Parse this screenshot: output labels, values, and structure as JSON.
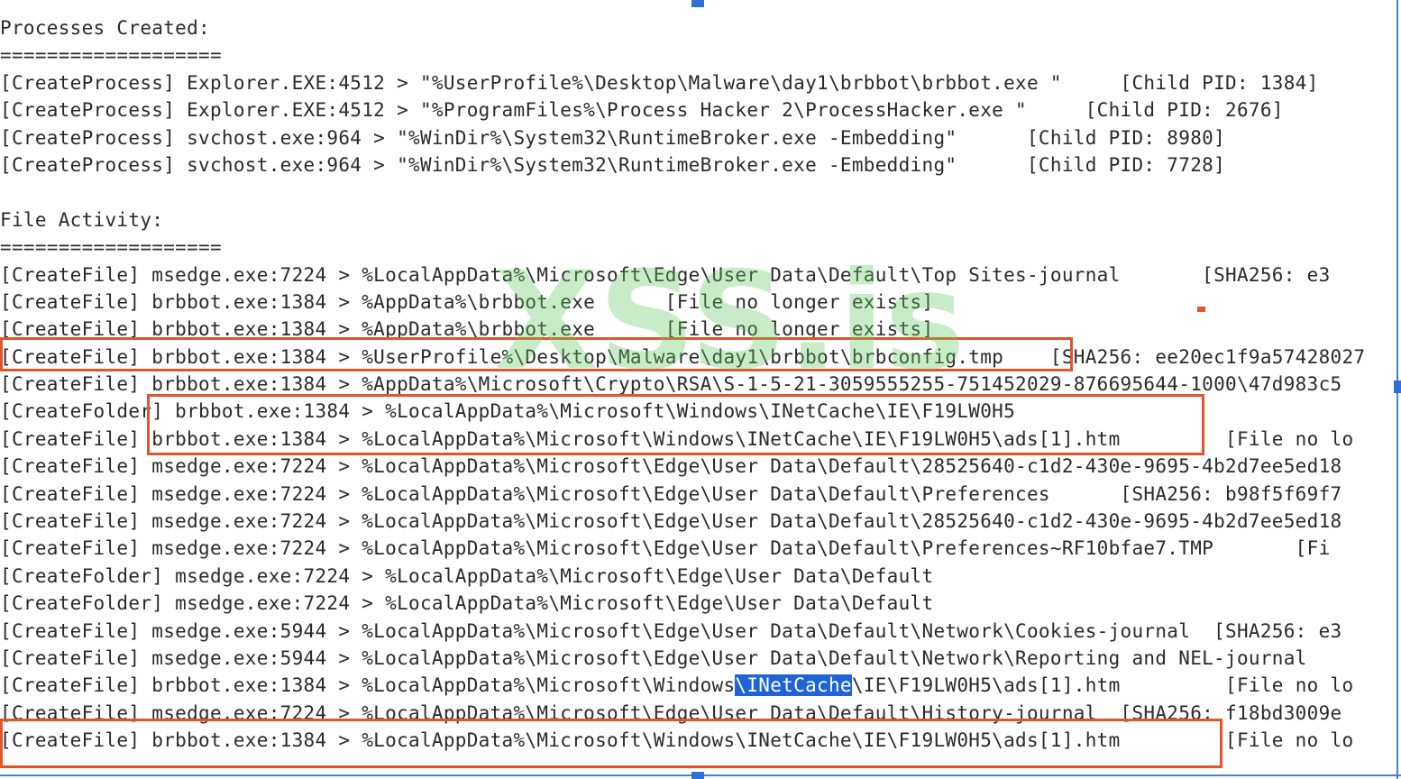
{
  "log": {
    "lines": [
      "Processes Created:",
      "===================",
      "[CreateProcess] Explorer.EXE:4512 > \"%UserProfile%\\Desktop\\Malware\\day1\\brbbot\\brbbot.exe \"     [Child PID: 1384]",
      "[CreateProcess] Explorer.EXE:4512 > \"%ProgramFiles%\\Process Hacker 2\\ProcessHacker.exe \"     [Child PID: 2676]",
      "[CreateProcess] svchost.exe:964 > \"%WinDir%\\System32\\RuntimeBroker.exe -Embedding\"      [Child PID: 8980]",
      "[CreateProcess] svchost.exe:964 > \"%WinDir%\\System32\\RuntimeBroker.exe -Embedding\"      [Child PID: 7728]",
      "",
      "File Activity:",
      "===================",
      "[CreateFile] msedge.exe:7224 > %LocalAppData%\\Microsoft\\Edge\\User Data\\Default\\Top Sites-journal       [SHA256: e3",
      "[CreateFile] brbbot.exe:1384 > %AppData%\\brbbot.exe      [File no longer exists]",
      "[CreateFile] brbbot.exe:1384 > %AppData%\\brbbot.exe      [File no longer exists]",
      "[CreateFile] brbbot.exe:1384 > %UserProfile%\\Desktop\\Malware\\day1\\brbbot\\brbconfig.tmp    [SHA256: ee20ec1f9a57428027",
      "[CreateFile] brbbot.exe:1384 > %AppData%\\Microsoft\\Crypto\\RSA\\S-1-5-21-3059555255-751452029-876695644-1000\\47d983c5",
      "[CreateFolder] brbbot.exe:1384 > %LocalAppData%\\Microsoft\\Windows\\INetCache\\IE\\F19LW0H5",
      "[CreateFile] brbbot.exe:1384 > %LocalAppData%\\Microsoft\\Windows\\INetCache\\IE\\F19LW0H5\\ads[1].htm         [File no lo",
      "[CreateFile] msedge.exe:7224 > %LocalAppData%\\Microsoft\\Edge\\User Data\\Default\\28525640-c1d2-430e-9695-4b2d7ee5ed18",
      "[CreateFile] msedge.exe:7224 > %LocalAppData%\\Microsoft\\Edge\\User Data\\Default\\Preferences      [SHA256: b98f5f69f7",
      "[CreateFile] msedge.exe:7224 > %LocalAppData%\\Microsoft\\Edge\\User Data\\Default\\28525640-c1d2-430e-9695-4b2d7ee5ed18",
      "[CreateFile] msedge.exe:7224 > %LocalAppData%\\Microsoft\\Edge\\User Data\\Default\\Preferences~RF10bfae7.TMP       [Fi",
      "[CreateFolder] msedge.exe:7224 > %LocalAppData%\\Microsoft\\Edge\\User Data\\Default",
      "[CreateFolder] msedge.exe:7224 > %LocalAppData%\\Microsoft\\Edge\\User Data\\Default",
      "[CreateFile] msedge.exe:5944 > %LocalAppData%\\Microsoft\\Edge\\User Data\\Default\\Network\\Cookies-journal  [SHA256: e3",
      "[CreateFile] msedge.exe:5944 > %LocalAppData%\\Microsoft\\Edge\\User Data\\Default\\Network\\Reporting and NEL-journal"
    ],
    "selection_line": {
      "before": "[CreateFile] brbbot.exe:1384 > %LocalAppData%\\Microsoft\\Windows",
      "selected": "\\INetCache",
      "after": "\\IE\\F19LW0H5\\ads[1].htm         [File no lo"
    },
    "tail_lines": [
      "[CreateFile] msedge.exe:7224 > %LocalAppData%\\Microsoft\\Edge\\User Data\\Default\\History-journal  [SHA256: f18bd3009e",
      "[CreateFile] brbbot.exe:1384 > %LocalAppData%\\Microsoft\\Windows\\INetCache\\IE\\F19LW0H5\\ads[1].htm         [File no lo"
    ]
  },
  "watermark": "XSS.is",
  "colors": {
    "highlight_box": "#e2542a",
    "selection": "#1f63d6",
    "frame": "#4a7fd0"
  }
}
